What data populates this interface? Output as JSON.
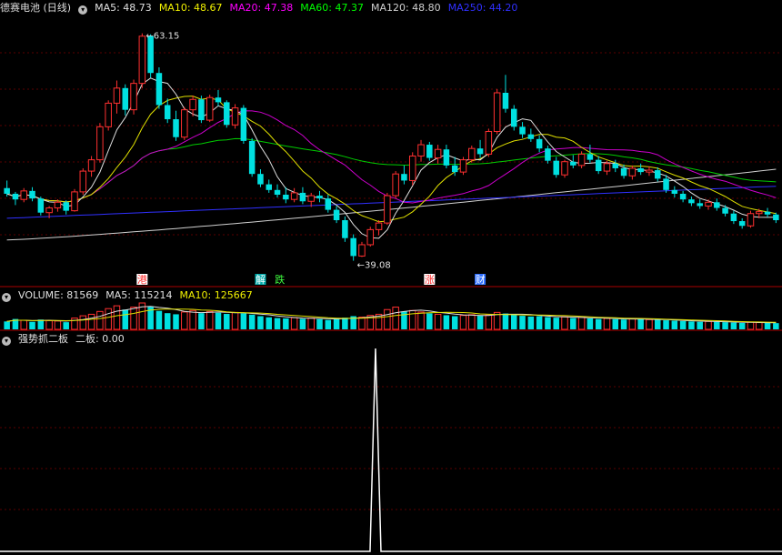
{
  "price_panel": {
    "title": "德赛电池 (日线)",
    "ma_labels": [
      {
        "text": "MA5: 48.73",
        "color": "#e0e0e0"
      },
      {
        "text": "MA10: 48.67",
        "color": "#f0f000"
      },
      {
        "text": "MA20: 47.38",
        "color": "#ff00ff"
      },
      {
        "text": "MA60: 47.37",
        "color": "#00ff00"
      },
      {
        "text": "MA120: 48.80",
        "color": "#d0d0d0"
      },
      {
        "text": "MA250: 44.20",
        "color": "#3030ff"
      }
    ],
    "high_label": "63.15",
    "low_label": "39.08",
    "markers": [
      {
        "text": "港",
        "color": "#ff3030",
        "bg": "#ffffff",
        "x": 16
      },
      {
        "text": "解",
        "color": "#ffffff",
        "bg": "#00aaaa",
        "x": 30
      },
      {
        "text": "跌",
        "color": "#40ff40",
        "bg": "#000000",
        "x": 31
      },
      {
        "text": "涨",
        "color": "#ff3030",
        "bg": "#ffffff",
        "x": 50
      },
      {
        "text": "财",
        "color": "#ffffff",
        "bg": "#3070ff",
        "x": 56
      }
    ]
  },
  "volume_panel": {
    "labels": [
      {
        "text": "VOLUME: 81569",
        "color": "#e0e0e0"
      },
      {
        "text": "MA5: 115214",
        "color": "#e0e0e0"
      },
      {
        "text": "MA10: 125667",
        "color": "#f0f000"
      }
    ]
  },
  "indicator_panel": {
    "labels": [
      {
        "text": "强势抓二板",
        "color": "#e0e0e0"
      },
      {
        "text": "二板: 0.00",
        "color": "#e0e0e0"
      }
    ]
  },
  "colors": {
    "up": "#ff3030",
    "down": "#00e0e0",
    "background": "#000000",
    "separator": "#aa0000"
  },
  "chart_data": {
    "type": "candlestick",
    "title": "德赛电池 (日线)",
    "ylim": [
      38,
      65
    ],
    "candles": [
      [
        46.8,
        47.6,
        45.9,
        46.2
      ],
      [
        46.2,
        46.4,
        45.0,
        45.6
      ],
      [
        45.6,
        46.8,
        45.3,
        46.5
      ],
      [
        46.5,
        46.9,
        45.4,
        45.7
      ],
      [
        45.7,
        45.9,
        43.9,
        44.2
      ],
      [
        44.2,
        44.9,
        43.6,
        44.7
      ],
      [
        44.7,
        45.6,
        44.3,
        45.3
      ],
      [
        45.3,
        45.5,
        44.0,
        44.4
      ],
      [
        44.4,
        46.7,
        44.3,
        46.4
      ],
      [
        46.4,
        48.9,
        46.1,
        48.6
      ],
      [
        48.6,
        50.2,
        48.0,
        49.8
      ],
      [
        49.8,
        53.7,
        49.5,
        53.3
      ],
      [
        53.3,
        56.1,
        52.9,
        55.8
      ],
      [
        55.8,
        58.2,
        54.7,
        57.4
      ],
      [
        57.4,
        57.8,
        54.5,
        55.1
      ],
      [
        55.1,
        58.3,
        54.6,
        57.9
      ],
      [
        57.9,
        63.2,
        57.4,
        62.9
      ],
      [
        62.9,
        63.1,
        58.5,
        59.0
      ],
      [
        59.0,
        59.6,
        55.2,
        55.6
      ],
      [
        55.6,
        56.3,
        53.7,
        54.1
      ],
      [
        54.1,
        55.0,
        51.8,
        52.2
      ],
      [
        52.2,
        55.4,
        51.9,
        55.1
      ],
      [
        55.1,
        56.6,
        54.4,
        56.2
      ],
      [
        56.2,
        56.6,
        53.7,
        54.0
      ],
      [
        54.0,
        56.7,
        53.8,
        56.4
      ],
      [
        56.4,
        57.2,
        55.5,
        55.9
      ],
      [
        55.9,
        56.1,
        53.2,
        53.5
      ],
      [
        53.5,
        55.7,
        53.1,
        55.3
      ],
      [
        55.3,
        55.6,
        51.5,
        51.8
      ],
      [
        51.8,
        52.1,
        48.0,
        48.3
      ],
      [
        48.3,
        48.8,
        46.9,
        47.2
      ],
      [
        47.2,
        47.7,
        46.3,
        46.6
      ],
      [
        46.6,
        47.2,
        45.8,
        46.1
      ],
      [
        46.1,
        46.9,
        45.2,
        45.6
      ],
      [
        45.6,
        46.8,
        45.3,
        46.3
      ],
      [
        46.3,
        46.9,
        45.1,
        45.4
      ],
      [
        45.4,
        46.3,
        44.8,
        46.0
      ],
      [
        46.0,
        46.5,
        45.3,
        45.7
      ],
      [
        45.7,
        46.1,
        44.2,
        44.5
      ],
      [
        44.5,
        44.9,
        43.1,
        43.4
      ],
      [
        43.4,
        43.8,
        41.1,
        41.5
      ],
      [
        41.5,
        41.9,
        39.1,
        39.6
      ],
      [
        39.6,
        41.1,
        39.5,
        40.8
      ],
      [
        40.8,
        42.7,
        40.6,
        42.4
      ],
      [
        42.4,
        43.4,
        41.8,
        43.1
      ],
      [
        43.1,
        46.3,
        42.9,
        46.0
      ],
      [
        46.0,
        48.6,
        45.7,
        48.3
      ],
      [
        48.3,
        49.2,
        47.2,
        47.6
      ],
      [
        47.6,
        50.6,
        47.1,
        50.2
      ],
      [
        50.2,
        51.9,
        49.6,
        51.4
      ],
      [
        51.4,
        51.7,
        49.7,
        50.0
      ],
      [
        50.0,
        51.4,
        49.4,
        50.9
      ],
      [
        50.9,
        51.4,
        48.9,
        49.2
      ],
      [
        49.2,
        50.1,
        48.1,
        48.5
      ],
      [
        48.5,
        50.1,
        48.2,
        49.8
      ],
      [
        49.8,
        51.3,
        49.5,
        51.0
      ],
      [
        51.0,
        51.9,
        50.0,
        50.4
      ],
      [
        50.4,
        53.1,
        50.1,
        52.8
      ],
      [
        52.8,
        57.3,
        52.5,
        56.9
      ],
      [
        56.9,
        58.8,
        54.8,
        55.2
      ],
      [
        55.2,
        55.6,
        52.9,
        53.3
      ],
      [
        53.3,
        53.8,
        52.1,
        52.5
      ],
      [
        52.5,
        53.1,
        51.7,
        52.0
      ],
      [
        52.0,
        52.4,
        50.6,
        51.0
      ],
      [
        51.0,
        51.3,
        49.4,
        49.7
      ],
      [
        49.7,
        50.1,
        47.9,
        48.2
      ],
      [
        48.2,
        49.8,
        47.9,
        49.6
      ],
      [
        49.6,
        50.3,
        48.9,
        49.2
      ],
      [
        49.2,
        50.7,
        48.9,
        50.4
      ],
      [
        50.4,
        51.4,
        49.5,
        49.8
      ],
      [
        49.8,
        50.2,
        48.3,
        48.6
      ],
      [
        48.6,
        49.7,
        48.2,
        49.4
      ],
      [
        49.4,
        49.8,
        48.5,
        48.9
      ],
      [
        48.9,
        49.3,
        47.8,
        48.1
      ],
      [
        48.1,
        49.2,
        47.7,
        48.9
      ],
      [
        48.9,
        49.4,
        48.2,
        48.5
      ],
      [
        48.5,
        49.1,
        48.1,
        48.7
      ],
      [
        48.7,
        49.0,
        47.5,
        47.8
      ],
      [
        47.8,
        48.2,
        46.3,
        46.6
      ],
      [
        46.6,
        47.0,
        45.8,
        46.2
      ],
      [
        46.2,
        46.5,
        45.3,
        45.6
      ],
      [
        45.6,
        45.9,
        44.9,
        45.2
      ],
      [
        45.2,
        45.6,
        44.6,
        44.9
      ],
      [
        44.9,
        45.6,
        44.5,
        45.3
      ],
      [
        45.3,
        45.7,
        44.4,
        44.7
      ],
      [
        44.7,
        45.0,
        43.8,
        44.1
      ],
      [
        44.1,
        44.4,
        43.0,
        43.3
      ],
      [
        43.3,
        43.6,
        42.5,
        42.8
      ],
      [
        42.8,
        44.4,
        42.6,
        44.1
      ],
      [
        44.1,
        44.6,
        43.6,
        44.3
      ],
      [
        44.3,
        44.7,
        43.7,
        44.0
      ],
      [
        44.0,
        44.2,
        43.1,
        43.4
      ]
    ],
    "volume": [
      42,
      55,
      48,
      40,
      52,
      46,
      44,
      38,
      60,
      72,
      80,
      95,
      110,
      125,
      105,
      118,
      140,
      120,
      98,
      86,
      80,
      92,
      100,
      86,
      95,
      88,
      82,
      90,
      85,
      78,
      70,
      64,
      60,
      58,
      62,
      56,
      60,
      54,
      50,
      58,
      62,
      70,
      65,
      74,
      80,
      105,
      118,
      95,
      100,
      92,
      85,
      80,
      75,
      70,
      74,
      78,
      72,
      76,
      90,
      84,
      78,
      72,
      68,
      70,
      65,
      62,
      66,
      60,
      64,
      58,
      55,
      58,
      54,
      52,
      56,
      54,
      52,
      50,
      48,
      46,
      44,
      42,
      40,
      42,
      40,
      38,
      36,
      34,
      38,
      36,
      35,
      33
    ],
    "indicator": {
      "name": "二板",
      "values_nonzero": [
        {
          "index": 42,
          "value": 1
        }
      ]
    }
  }
}
